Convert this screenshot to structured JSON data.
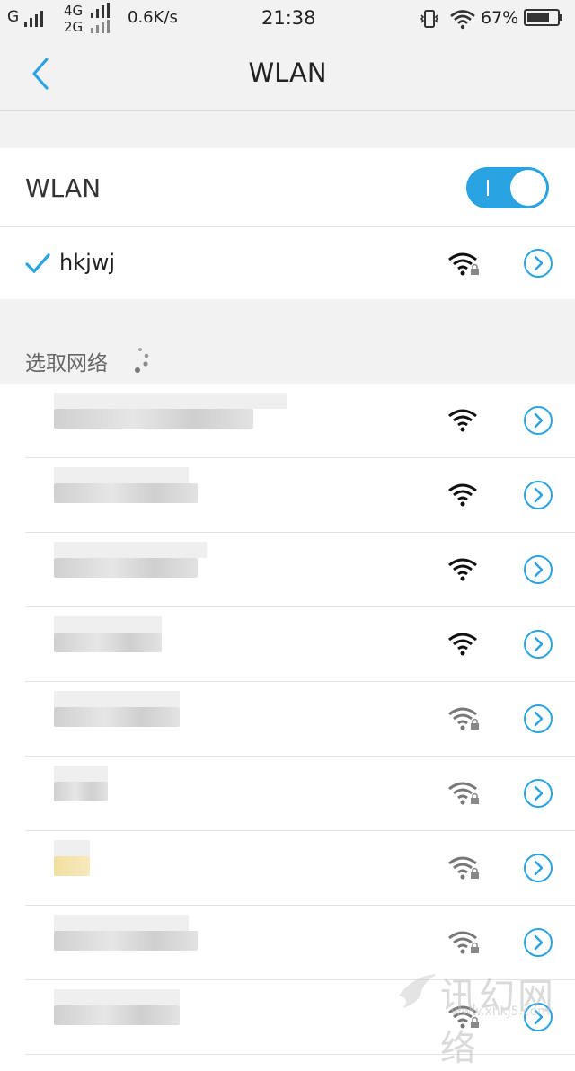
{
  "status_bar": {
    "carrier_1": "G",
    "net_4g": "4G",
    "net_2g": "2G",
    "speed": "0.6K/s",
    "time": "21:38",
    "battery": "67%",
    "icons": [
      "signal-icon",
      "vibrate-icon",
      "wifi-icon",
      "battery-icon"
    ]
  },
  "header": {
    "title": "WLAN",
    "back_icon": "chevron-left-icon"
  },
  "wlan_toggle": {
    "label": "WLAN",
    "state": "on"
  },
  "connected": {
    "name": "hkjwj",
    "secured": true
  },
  "available": {
    "title": "选取网络",
    "networks": [
      {
        "name": "",
        "signal": "strong",
        "secured": false
      },
      {
        "name": "",
        "signal": "strong",
        "secured": false
      },
      {
        "name": "",
        "signal": "strong",
        "secured": false
      },
      {
        "name": "",
        "signal": "strong",
        "secured": false
      },
      {
        "name": "",
        "signal": "medium",
        "secured": true
      },
      {
        "name": "",
        "signal": "medium",
        "secured": true
      },
      {
        "name": "",
        "signal": "medium",
        "secured": true
      },
      {
        "name": "",
        "signal": "medium",
        "secured": true
      },
      {
        "name": "",
        "signal": "medium",
        "secured": true
      }
    ]
  },
  "watermark": {
    "text": "讯幻网络",
    "url": "www.xhkj5.com"
  },
  "colors": {
    "accent": "#2aa3e2",
    "background": "#f2f2f2"
  }
}
